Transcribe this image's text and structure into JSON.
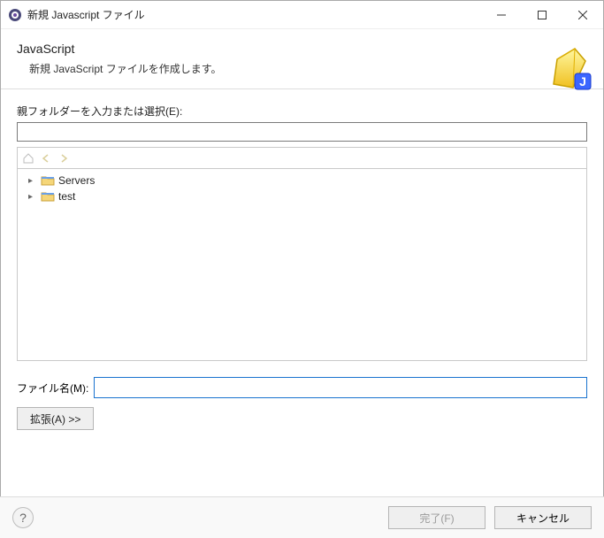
{
  "window": {
    "title": "新規 Javascript ファイル"
  },
  "banner": {
    "heading": "JavaScript",
    "description": "新規 JavaScript ファイルを作成します。"
  },
  "parentFolder": {
    "label": "親フォルダーを入力または選択(E):",
    "value": ""
  },
  "tree": {
    "items": [
      {
        "label": "Servers"
      },
      {
        "label": "test"
      }
    ]
  },
  "filename": {
    "label": "ファイル名(M):",
    "value": ""
  },
  "buttons": {
    "advanced": "拡張(A) >>",
    "finish": "完了(F)",
    "cancel": "キャンセル"
  }
}
